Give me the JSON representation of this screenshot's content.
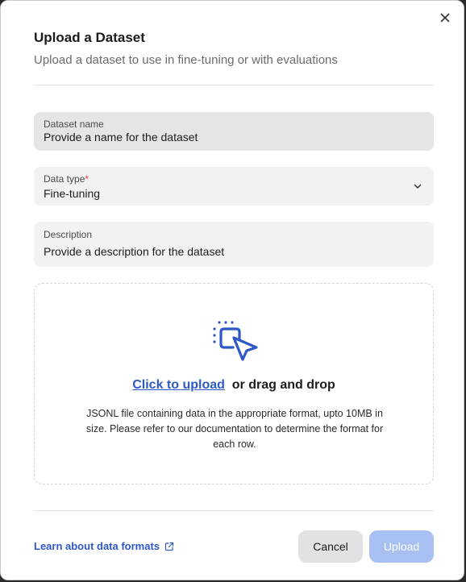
{
  "dialog": {
    "title": "Upload a Dataset",
    "subtitle": "Upload a dataset to use in fine-tuning or with evaluations"
  },
  "form": {
    "name": {
      "label": "Dataset name",
      "placeholder": "Provide a name for the dataset"
    },
    "type": {
      "label": "Data type",
      "required_mark": "*",
      "value": "Fine-tuning"
    },
    "description": {
      "label": "Description",
      "placeholder": "Provide a description for the dataset"
    }
  },
  "dropzone": {
    "link_text": "Click to upload",
    "rest_text": "or drag and drop",
    "hint": "JSONL file containing data in the appropriate format, upto 10MB in size. Please refer to our documentation to determine the format for each row."
  },
  "footer": {
    "learn_link": "Learn about data formats",
    "cancel_label": "Cancel",
    "upload_label": "Upload"
  },
  "colors": {
    "accent": "#2e57c8",
    "upload_disabled": "#a8bff2",
    "required": "#e0403a"
  }
}
